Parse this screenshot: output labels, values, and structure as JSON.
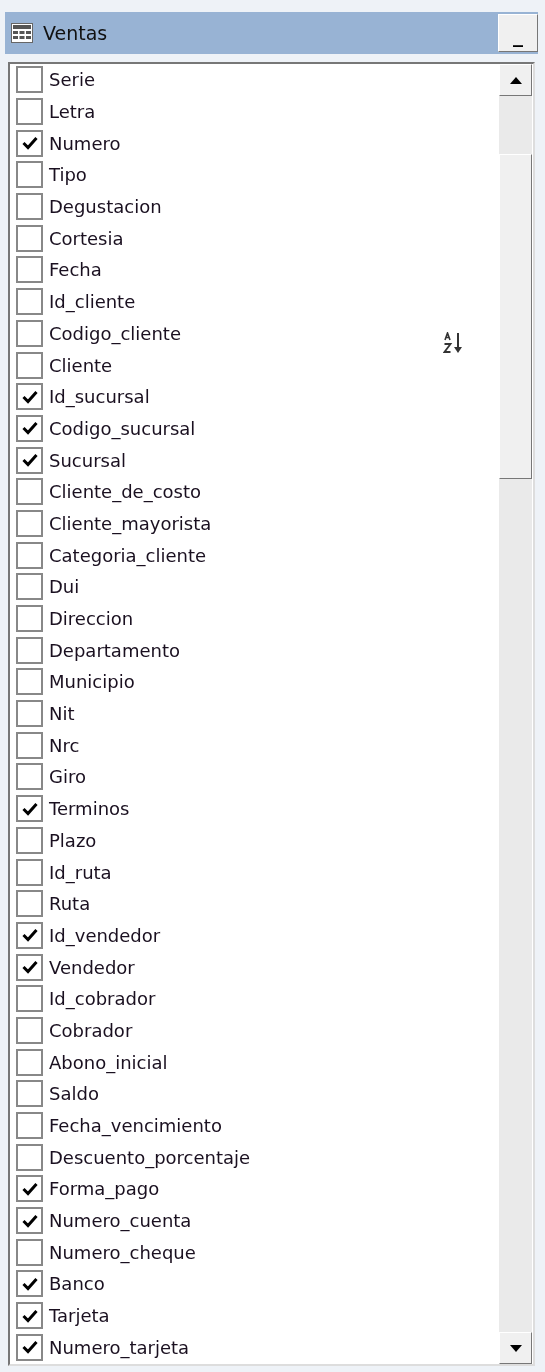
{
  "window": {
    "title": "Ventas",
    "minimize_button": "_"
  },
  "fields": [
    {
      "label": "Serie",
      "checked": false
    },
    {
      "label": "Letra",
      "checked": false
    },
    {
      "label": "Numero",
      "checked": true
    },
    {
      "label": "Tipo",
      "checked": false
    },
    {
      "label": "Degustacion",
      "checked": false
    },
    {
      "label": "Cortesia",
      "checked": false
    },
    {
      "label": "Fecha",
      "checked": false
    },
    {
      "label": "Id_cliente",
      "checked": false
    },
    {
      "label": "Codigo_cliente",
      "checked": false
    },
    {
      "label": "Cliente",
      "checked": false
    },
    {
      "label": "Id_sucursal",
      "checked": true
    },
    {
      "label": "Codigo_sucursal",
      "checked": true
    },
    {
      "label": "Sucursal",
      "checked": true
    },
    {
      "label": "Cliente_de_costo",
      "checked": false
    },
    {
      "label": "Cliente_mayorista",
      "checked": false
    },
    {
      "label": "Categoria_cliente",
      "checked": false
    },
    {
      "label": "Dui",
      "checked": false
    },
    {
      "label": "Direccion",
      "checked": false
    },
    {
      "label": "Departamento",
      "checked": false
    },
    {
      "label": "Municipio",
      "checked": false
    },
    {
      "label": "Nit",
      "checked": false
    },
    {
      "label": "Nrc",
      "checked": false
    },
    {
      "label": "Giro",
      "checked": false
    },
    {
      "label": "Terminos",
      "checked": true
    },
    {
      "label": "Plazo",
      "checked": false
    },
    {
      "label": "Id_ruta",
      "checked": false
    },
    {
      "label": "Ruta",
      "checked": false
    },
    {
      "label": "Id_vendedor",
      "checked": true
    },
    {
      "label": "Vendedor",
      "checked": true
    },
    {
      "label": "Id_cobrador",
      "checked": false
    },
    {
      "label": "Cobrador",
      "checked": false
    },
    {
      "label": "Abono_inicial",
      "checked": false
    },
    {
      "label": "Saldo",
      "checked": false
    },
    {
      "label": "Fecha_vencimiento",
      "checked": false
    },
    {
      "label": "Descuento_porcentaje",
      "checked": false
    },
    {
      "label": "Forma_pago",
      "checked": true
    },
    {
      "label": "Numero_cuenta",
      "checked": true
    },
    {
      "label": "Numero_cheque",
      "checked": false
    },
    {
      "label": "Banco",
      "checked": true
    },
    {
      "label": "Tarjeta",
      "checked": true
    },
    {
      "label": "Numero_tarjeta",
      "checked": true
    }
  ]
}
